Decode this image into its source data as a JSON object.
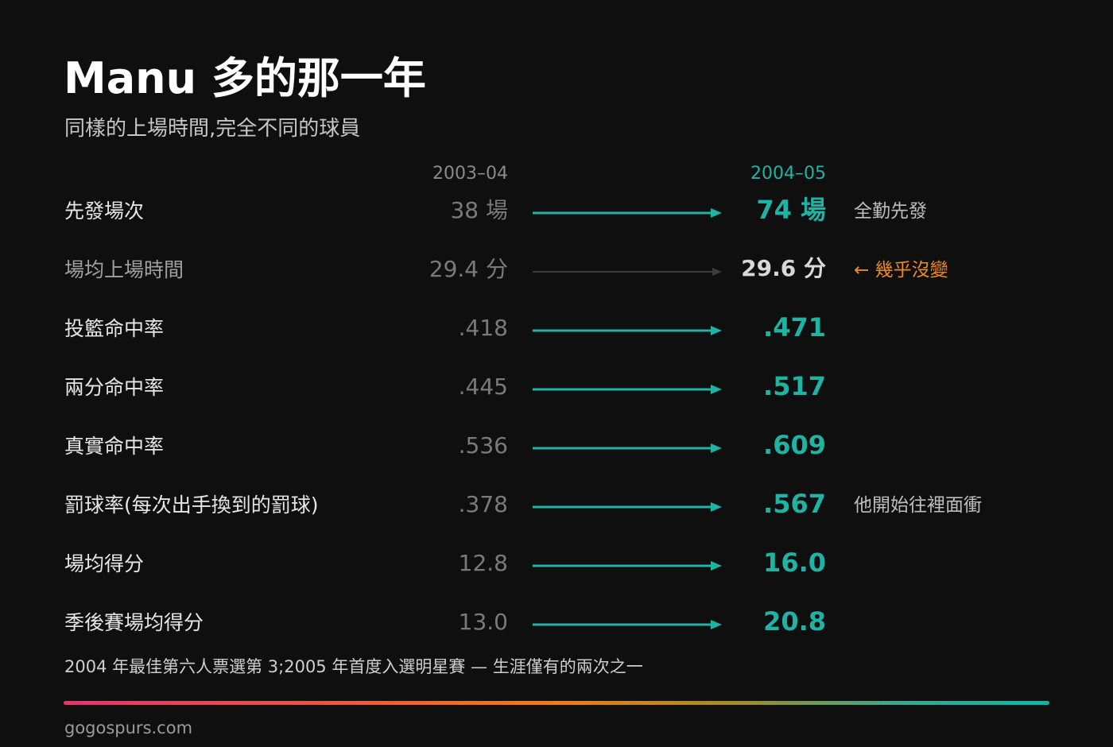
{
  "header": {
    "title": "Manu 多的那一年",
    "subtitle": "同樣的上場時間,完全不同的球員"
  },
  "columns": {
    "before": "2003–04",
    "after": "2004–05"
  },
  "rows": [
    {
      "label": "先發場次",
      "before": "38 場",
      "after": "74 場",
      "note": "全勤先發"
    },
    {
      "label": "場均上場時間",
      "before": "29.4 分",
      "after": "29.6 分",
      "note": "← 幾乎沒變"
    },
    {
      "label": "投籃命中率",
      "before": ".418",
      "after": ".471",
      "note": ""
    },
    {
      "label": "兩分命中率",
      "before": ".445",
      "after": ".517",
      "note": ""
    },
    {
      "label": "真實命中率",
      "before": ".536",
      "after": ".609",
      "note": ""
    },
    {
      "label": "罰球率(每次出手換到的罰球)",
      "before": ".378",
      "after": ".567",
      "note": "他開始往裡面衝"
    },
    {
      "label": "場均得分",
      "before": "12.8",
      "after": "16.0",
      "note": ""
    },
    {
      "label": "季後賽場均得分",
      "before": "13.0",
      "after": "20.8",
      "note": ""
    }
  ],
  "footnote": "2004 年最佳第六人票選第 3;2005 年首度入選明星賽 — 生涯僅有的兩次之一",
  "site": "gogospurs.com",
  "colors": {
    "background": "#0f0f10",
    "accent": "#1fb3a4",
    "warning": "#ef8a1d",
    "muted_arrow": "#3c3c3c"
  }
}
